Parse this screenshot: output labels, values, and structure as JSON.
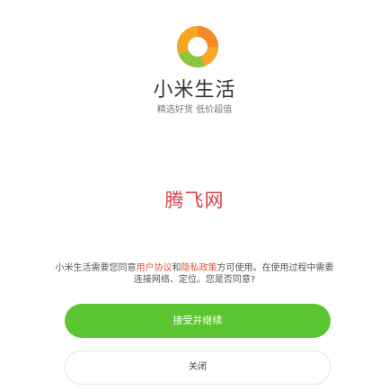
{
  "app": {
    "name": "小米生活",
    "slogan": "精选好货 低价超值",
    "logo_icon": "orange-green-ring-logo-icon",
    "logo_colors": [
      "#f6a623",
      "#f58a2b",
      "#8cc63f"
    ]
  },
  "watermark": {
    "text": "腾飞网"
  },
  "consent": {
    "part1": "小米生活需要您同意",
    "link1": "用户协议",
    "part2": "和",
    "link2": "隐私政策",
    "part3": "方可使用。在使用过程中需要连接网络、定位。您是否同意?"
  },
  "buttons": {
    "accept_label": "接受并继续",
    "close_label": "关闭"
  },
  "colors": {
    "accept_bg": "#5bc531",
    "link": "#e0563b",
    "watermark": "#d8404a"
  }
}
